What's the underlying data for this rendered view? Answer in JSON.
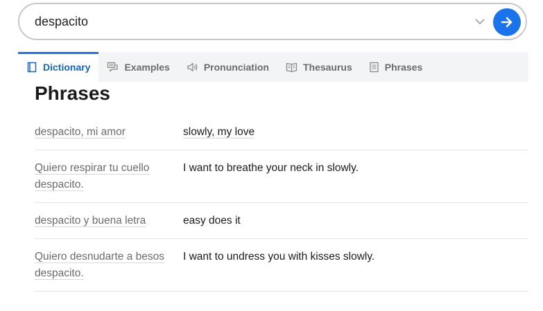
{
  "search": {
    "value": "despacito",
    "accent_color": "#1a73e8"
  },
  "tabs": [
    {
      "label": "Dictionary",
      "icon": "book-icon",
      "active": true
    },
    {
      "label": "Examples",
      "icon": "speech-bubbles-icon",
      "active": false
    },
    {
      "label": "Pronunciation",
      "icon": "speaker-icon",
      "active": false
    },
    {
      "label": "Thesaurus",
      "icon": "open-book-icon",
      "active": false
    },
    {
      "label": "Phrases",
      "icon": "document-icon",
      "active": false
    }
  ],
  "section_title": "Phrases",
  "phrases": [
    {
      "source": "despacito, mi amor",
      "translation": "slowly, my love"
    },
    {
      "source": "Quiero respirar tu cuello despacito.",
      "translation": "I want to breathe your neck in slowly."
    },
    {
      "source": "despacito y buena letra",
      "translation": "easy does it"
    },
    {
      "source": "Quiero desnudarte a besos despacito.",
      "translation": "I want to undress you with kisses slowly."
    }
  ]
}
